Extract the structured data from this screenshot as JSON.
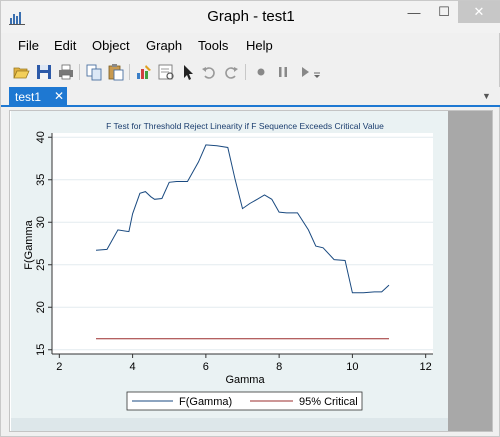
{
  "window": {
    "title": "Graph - test1",
    "minimize_glyph": "—",
    "maximize_glyph": "☐",
    "close_glyph": "✕"
  },
  "menu": [
    "File",
    "Edit",
    "Object",
    "Graph",
    "Tools",
    "Help"
  ],
  "toolbar": {
    "icons": [
      "open-icon",
      "save-icon",
      "print-icon",
      "copy-icon",
      "paste-icon",
      "graph-editor-icon",
      "properties-icon",
      "pointer-icon",
      "add-text-icon",
      "undo-icon",
      "redo-icon",
      "record-icon",
      "pause-icon",
      "play-icon",
      "dropdown-icon"
    ]
  },
  "tab": {
    "label": "test1",
    "close_glyph": "✕",
    "menu_glyph": "▼"
  },
  "colors": {
    "accent": "#1e78d2",
    "plot_bg": "#eaf2f3",
    "series1": "#1a4a80",
    "series2": "#9b2d2d"
  },
  "chart_data": {
    "type": "line",
    "title": "F Test for Threshold Reject Linearity if F Sequence Exceeds Critical Value",
    "xlabel": "Gamma",
    "ylabel": "F(Gamma",
    "xlim": [
      1.8,
      12.2
    ],
    "ylim": [
      14.5,
      40.5
    ],
    "xticks": [
      2,
      4,
      6,
      8,
      10,
      12
    ],
    "yticks": [
      15,
      20,
      25,
      30,
      35,
      40
    ],
    "grid": "horizontal",
    "legend_position": "bottom",
    "series": [
      {
        "name": "F(Gamma)",
        "color": "#1a4a80",
        "x": [
          3.0,
          3.3,
          3.6,
          3.9,
          4.0,
          4.2,
          4.35,
          4.5,
          4.6,
          4.8,
          5.0,
          5.2,
          5.5,
          5.8,
          6.0,
          6.3,
          6.6,
          6.8,
          7.0,
          7.2,
          7.4,
          7.6,
          7.8,
          8.0,
          8.2,
          8.5,
          8.8,
          9.0,
          9.2,
          9.5,
          9.8,
          10.0,
          10.3,
          10.6,
          10.8,
          11.0
        ],
        "y": [
          26.7,
          26.8,
          29.1,
          28.9,
          31.0,
          33.4,
          33.6,
          33.0,
          32.7,
          32.8,
          34.7,
          34.8,
          34.8,
          37.1,
          39.1,
          39.0,
          38.8,
          35.0,
          31.6,
          32.2,
          32.7,
          33.2,
          32.7,
          31.2,
          31.1,
          31.1,
          29.1,
          27.2,
          27.0,
          25.6,
          25.5,
          21.7,
          21.7,
          21.8,
          21.8,
          22.6
        ]
      },
      {
        "name": "95% Critical",
        "color": "#9b2d2d",
        "x": [
          3.0,
          11.0
        ],
        "y": [
          16.3,
          16.3
        ]
      }
    ]
  }
}
